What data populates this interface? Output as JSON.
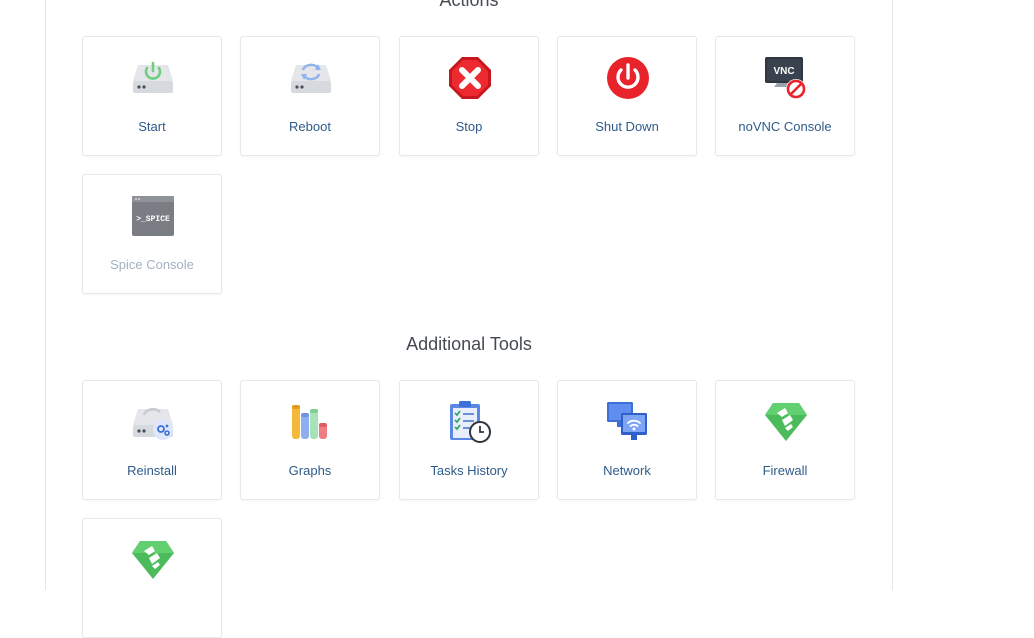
{
  "actions": {
    "title": "Actions",
    "items": [
      {
        "label": "Start",
        "icon": "power-drive-green-icon"
      },
      {
        "label": "Reboot",
        "icon": "reboot-drive-icon"
      },
      {
        "label": "Stop",
        "icon": "stop-octagon-icon"
      },
      {
        "label": "Shut Down",
        "icon": "power-red-icon"
      },
      {
        "label": "noVNC Console",
        "icon": "vnc-disabled-icon"
      },
      {
        "label": "Spice Console",
        "icon": "spice-terminal-icon",
        "disabled": true
      }
    ]
  },
  "tools": {
    "title": "Additional Tools",
    "items": [
      {
        "label": "Reinstall",
        "icon": "reinstall-drive-icon"
      },
      {
        "label": "Graphs",
        "icon": "graphs-icon"
      },
      {
        "label": "Tasks History",
        "icon": "tasks-clipboard-icon"
      },
      {
        "label": "Network",
        "icon": "network-monitors-icon"
      },
      {
        "label": "Firewall",
        "icon": "firewall-gem-icon"
      },
      {
        "label": "",
        "icon": "firewall-gem-icon"
      }
    ]
  },
  "icons": {
    "vnc_text": "VNC",
    "spice_text": ">_SPICE"
  },
  "colors": {
    "accent_text": "#2e5b8a",
    "disabled_text": "#a3b2c2",
    "green": "#5cc46a",
    "red": "#e8232b",
    "blue": "#3d6fd9"
  }
}
